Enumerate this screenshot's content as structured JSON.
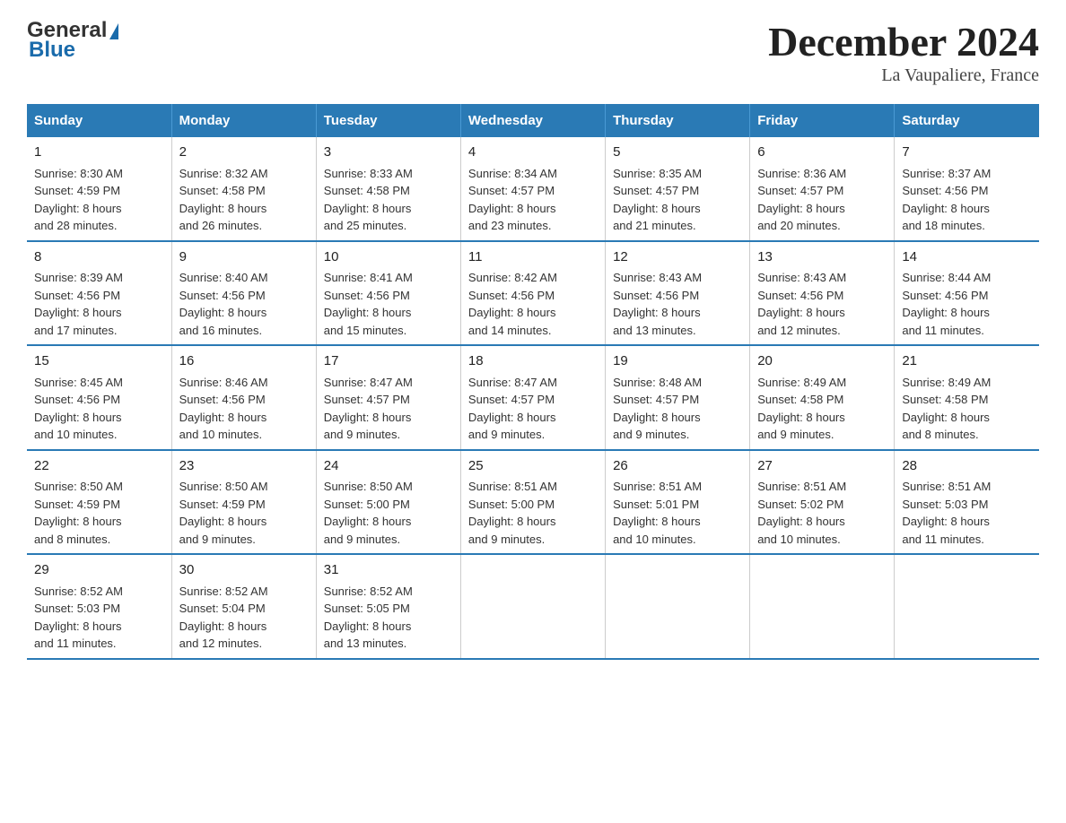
{
  "header": {
    "logo_line1": "General",
    "logo_line2": "Blue",
    "title": "December 2024",
    "subtitle": "La Vaupaliere, France"
  },
  "days_of_week": [
    "Sunday",
    "Monday",
    "Tuesday",
    "Wednesday",
    "Thursday",
    "Friday",
    "Saturday"
  ],
  "weeks": [
    [
      {
        "day": "1",
        "sunrise": "8:30 AM",
        "sunset": "4:59 PM",
        "daylight": "8 hours and 28 minutes."
      },
      {
        "day": "2",
        "sunrise": "8:32 AM",
        "sunset": "4:58 PM",
        "daylight": "8 hours and 26 minutes."
      },
      {
        "day": "3",
        "sunrise": "8:33 AM",
        "sunset": "4:58 PM",
        "daylight": "8 hours and 25 minutes."
      },
      {
        "day": "4",
        "sunrise": "8:34 AM",
        "sunset": "4:57 PM",
        "daylight": "8 hours and 23 minutes."
      },
      {
        "day": "5",
        "sunrise": "8:35 AM",
        "sunset": "4:57 PM",
        "daylight": "8 hours and 21 minutes."
      },
      {
        "day": "6",
        "sunrise": "8:36 AM",
        "sunset": "4:57 PM",
        "daylight": "8 hours and 20 minutes."
      },
      {
        "day": "7",
        "sunrise": "8:37 AM",
        "sunset": "4:56 PM",
        "daylight": "8 hours and 18 minutes."
      }
    ],
    [
      {
        "day": "8",
        "sunrise": "8:39 AM",
        "sunset": "4:56 PM",
        "daylight": "8 hours and 17 minutes."
      },
      {
        "day": "9",
        "sunrise": "8:40 AM",
        "sunset": "4:56 PM",
        "daylight": "8 hours and 16 minutes."
      },
      {
        "day": "10",
        "sunrise": "8:41 AM",
        "sunset": "4:56 PM",
        "daylight": "8 hours and 15 minutes."
      },
      {
        "day": "11",
        "sunrise": "8:42 AM",
        "sunset": "4:56 PM",
        "daylight": "8 hours and 14 minutes."
      },
      {
        "day": "12",
        "sunrise": "8:43 AM",
        "sunset": "4:56 PM",
        "daylight": "8 hours and 13 minutes."
      },
      {
        "day": "13",
        "sunrise": "8:43 AM",
        "sunset": "4:56 PM",
        "daylight": "8 hours and 12 minutes."
      },
      {
        "day": "14",
        "sunrise": "8:44 AM",
        "sunset": "4:56 PM",
        "daylight": "8 hours and 11 minutes."
      }
    ],
    [
      {
        "day": "15",
        "sunrise": "8:45 AM",
        "sunset": "4:56 PM",
        "daylight": "8 hours and 10 minutes."
      },
      {
        "day": "16",
        "sunrise": "8:46 AM",
        "sunset": "4:56 PM",
        "daylight": "8 hours and 10 minutes."
      },
      {
        "day": "17",
        "sunrise": "8:47 AM",
        "sunset": "4:57 PM",
        "daylight": "8 hours and 9 minutes."
      },
      {
        "day": "18",
        "sunrise": "8:47 AM",
        "sunset": "4:57 PM",
        "daylight": "8 hours and 9 minutes."
      },
      {
        "day": "19",
        "sunrise": "8:48 AM",
        "sunset": "4:57 PM",
        "daylight": "8 hours and 9 minutes."
      },
      {
        "day": "20",
        "sunrise": "8:49 AM",
        "sunset": "4:58 PM",
        "daylight": "8 hours and 9 minutes."
      },
      {
        "day": "21",
        "sunrise": "8:49 AM",
        "sunset": "4:58 PM",
        "daylight": "8 hours and 8 minutes."
      }
    ],
    [
      {
        "day": "22",
        "sunrise": "8:50 AM",
        "sunset": "4:59 PM",
        "daylight": "8 hours and 8 minutes."
      },
      {
        "day": "23",
        "sunrise": "8:50 AM",
        "sunset": "4:59 PM",
        "daylight": "8 hours and 9 minutes."
      },
      {
        "day": "24",
        "sunrise": "8:50 AM",
        "sunset": "5:00 PM",
        "daylight": "8 hours and 9 minutes."
      },
      {
        "day": "25",
        "sunrise": "8:51 AM",
        "sunset": "5:00 PM",
        "daylight": "8 hours and 9 minutes."
      },
      {
        "day": "26",
        "sunrise": "8:51 AM",
        "sunset": "5:01 PM",
        "daylight": "8 hours and 10 minutes."
      },
      {
        "day": "27",
        "sunrise": "8:51 AM",
        "sunset": "5:02 PM",
        "daylight": "8 hours and 10 minutes."
      },
      {
        "day": "28",
        "sunrise": "8:51 AM",
        "sunset": "5:03 PM",
        "daylight": "8 hours and 11 minutes."
      }
    ],
    [
      {
        "day": "29",
        "sunrise": "8:52 AM",
        "sunset": "5:03 PM",
        "daylight": "8 hours and 11 minutes."
      },
      {
        "day": "30",
        "sunrise": "8:52 AM",
        "sunset": "5:04 PM",
        "daylight": "8 hours and 12 minutes."
      },
      {
        "day": "31",
        "sunrise": "8:52 AM",
        "sunset": "5:05 PM",
        "daylight": "8 hours and 13 minutes."
      },
      null,
      null,
      null,
      null
    ]
  ],
  "labels": {
    "sunrise": "Sunrise:",
    "sunset": "Sunset:",
    "daylight": "Daylight:"
  }
}
